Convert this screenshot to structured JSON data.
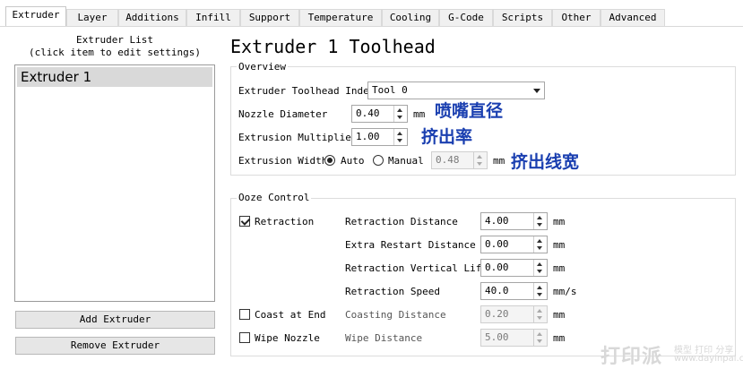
{
  "tabs": [
    "Extruder",
    "Layer",
    "Additions",
    "Infill",
    "Support",
    "Temperature",
    "Cooling",
    "G-Code",
    "Scripts",
    "Other",
    "Advanced"
  ],
  "sidebar": {
    "list_title": "Extruder List",
    "list_hint": "(click item to edit settings)",
    "items": [
      "Extruder 1"
    ],
    "add_button": "Add Extruder",
    "remove_button": "Remove Extruder"
  },
  "main": {
    "title": "Extruder 1 Toolhead",
    "overview": {
      "group_title": "Overview",
      "toolhead_index_label": "Extruder Toolhead Index",
      "toolhead_index_value": "Tool 0",
      "nozzle_label": "Nozzle Diameter",
      "nozzle_value": "0.40",
      "nozzle_unit": "mm",
      "multiplier_label": "Extrusion Multiplier",
      "multiplier_value": "1.00",
      "width_label": "Extrusion Width",
      "width_auto": "Auto",
      "width_manual": "Manual",
      "width_value": "0.48",
      "width_unit": "mm"
    },
    "ooze": {
      "group_title": "Ooze Control",
      "retraction_label": "Retraction",
      "retraction_distance_label": "Retraction Distance",
      "retraction_distance_value": "4.00",
      "extra_restart_label": "Extra Restart Distance",
      "extra_restart_value": "0.00",
      "vertical_lift_label": "Retraction Vertical Lift",
      "vertical_lift_value": "0.00",
      "retraction_speed_label": "Retraction Speed",
      "retraction_speed_value": "40.0",
      "speed_unit": "mm/s",
      "coast_label": "Coast at End",
      "coasting_distance_label": "Coasting Distance",
      "coasting_distance_value": "0.20",
      "wipe_label": "Wipe Nozzle",
      "wipe_distance_label": "Wipe Distance",
      "wipe_distance_value": "5.00",
      "unit_mm": "mm"
    }
  },
  "annotations": {
    "nozzle": "喷嘴直径",
    "multiplier": "挤出率",
    "width": "挤出线宽"
  },
  "watermark": {
    "big": "打印派",
    "line1": "模型 打印 分享",
    "line2": "www.dayinpai.com"
  },
  "colors": {
    "annotation": "#1a3fb0",
    "list_selection": "#d9d9d9"
  }
}
